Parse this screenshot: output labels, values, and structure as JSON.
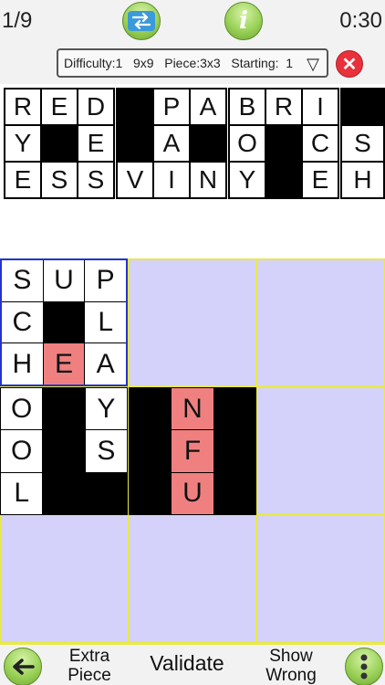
{
  "header": {
    "level": "1/9",
    "timer": "0:30",
    "swap_icon": "swap-arrows-icon",
    "info_icon": "info-icon",
    "info_glyph": "i"
  },
  "settings": {
    "text": "Difficulty:1   9x9   Piece:3x3   Starting:  1",
    "arrow": "▽",
    "close_glyph": "✕"
  },
  "tray": [
    {
      "cells": [
        "R",
        "E",
        "D",
        "Y",
        "#",
        "E",
        "E",
        "S",
        "S"
      ]
    },
    {
      "cells": [
        "#",
        "P",
        "A",
        "#",
        "A",
        "#",
        "V",
        "I",
        "N"
      ]
    },
    {
      "cells": [
        "B",
        "R",
        "I",
        "O",
        "#",
        "C",
        "Y",
        "#",
        "E"
      ]
    },
    {
      "cells": [
        "#",
        "#",
        "#",
        "S",
        "",
        "",
        " H",
        "",
        ""
      ]
    }
  ],
  "board": {
    "pieces": [
      {
        "id": "top-left",
        "cells": [
          "S",
          "U",
          "P",
          "C",
          "#",
          "L",
          "H",
          "E*",
          "A"
        ]
      },
      {
        "id": "middle-left",
        "cells": [
          "O",
          "#",
          "Y",
          "O",
          "#",
          "S",
          "L",
          "#",
          "#"
        ]
      },
      {
        "id": "middle-center",
        "cells": [
          "#",
          "N*",
          "#",
          "#",
          "F*",
          "#",
          "#",
          "U*",
          "#"
        ]
      }
    ]
  },
  "bottom": {
    "back_icon": "back-arrow-icon",
    "extra_piece": "Extra Piece",
    "validate": "Validate",
    "show_wrong": "Show Wrong",
    "more_icon": "more-dots-icon"
  },
  "colors": {
    "board_border": "#e8e84a",
    "empty_slot": "#d4d2fa",
    "wrong_cell": "#f08080",
    "selected_border": "#2233cc",
    "button_green": "#9ad158",
    "close_red": "#e8313b"
  }
}
